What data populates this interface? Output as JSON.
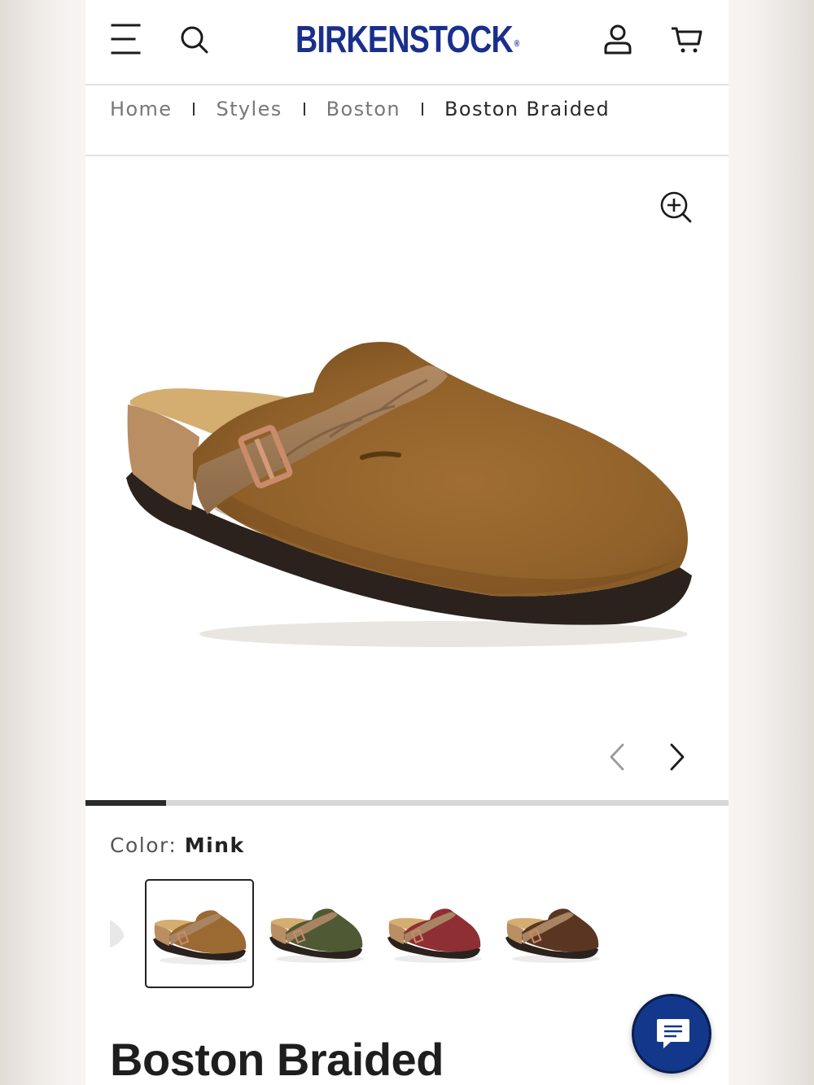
{
  "header": {
    "menu_icon": "hamburger-menu-icon",
    "search_icon": "search-icon",
    "logo_text": "BIRKENSTOCK",
    "logo_mark": "®",
    "account_icon": "user-icon",
    "cart_icon": "cart-icon",
    "brand_color": "#1a2f8c"
  },
  "breadcrumb": {
    "items": [
      "Home",
      "Styles",
      "Boston",
      "Boston Braided"
    ]
  },
  "gallery": {
    "zoom_icon": "zoom-in-icon",
    "prev_icon": "chevron-left-icon",
    "next_icon": "chevron-right-icon",
    "progress_fraction": 0.125,
    "main_image": "Boston Braided clog in Mink suede"
  },
  "color": {
    "label": "Color:",
    "value": "Mink",
    "swatches": [
      {
        "name": "Mink",
        "upper": "#9a6a32",
        "selected": true
      },
      {
        "name": "Green",
        "upper": "#4f5a34",
        "selected": false
      },
      {
        "name": "Red",
        "upper": "#8e2f33",
        "selected": false
      },
      {
        "name": "Brown",
        "upper": "#5a3622",
        "selected": false
      }
    ]
  },
  "product": {
    "title": "Boston Braided"
  },
  "chat": {
    "icon": "chat-icon",
    "color": "#13378a"
  }
}
